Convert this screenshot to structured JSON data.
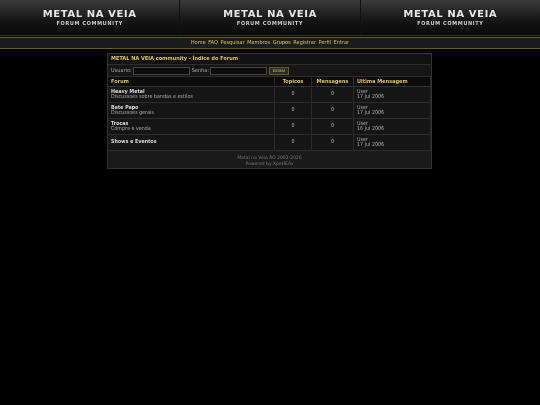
{
  "banner": {
    "cells": [
      {
        "title": "METAL NA VEIA",
        "subtitle": "FORUM COMMUNITY"
      },
      {
        "title": "METAL NA VEIA",
        "subtitle": "FORUM COMMUNITY"
      },
      {
        "title": "METAL NA VEIA",
        "subtitle": "FORUM COMMUNITY"
      }
    ]
  },
  "nav": [
    "Home",
    "FAQ",
    "Pesquisar",
    "Membros",
    "Grupos",
    "Registrar",
    "Perfil",
    "Entrar"
  ],
  "breadcrumb": "METAL NA VEIA community - Índice do Forum",
  "login": {
    "user_label": "Usuario:",
    "pass_label": "Senha:",
    "submit": "Entrar",
    "user_value": "",
    "pass_value": ""
  },
  "table": {
    "headers": [
      "Forum",
      "Topicos",
      "Mensagens",
      "Ultima Mensagem"
    ],
    "rows": [
      {
        "name": "Heavy Metal",
        "desc": "Discussoes sobre bandas e estilos",
        "topics": "0",
        "posts": "0",
        "last_user": "User",
        "last_date": "17 Jul 2006"
      },
      {
        "name": "Bate Papo",
        "desc": "Discussoes gerais",
        "topics": "0",
        "posts": "0",
        "last_user": "User",
        "last_date": "17 Jul 2006"
      },
      {
        "name": "Trocas",
        "desc": "Compra e venda",
        "topics": "0",
        "posts": "0",
        "last_user": "User",
        "last_date": "16 Jul 2006"
      },
      {
        "name": "Shows e Eventos",
        "desc": "",
        "topics": "0",
        "posts": "0",
        "last_user": "User",
        "last_date": "17 Jul 2006"
      }
    ]
  },
  "footer": {
    "line1": "Metal na Veia ÃO 2002-2026",
    "line2": "Powered by XpeHEAv"
  },
  "colors": {
    "accent": "#e3c548",
    "background": "#000000",
    "panel": "#1a1a1a"
  }
}
